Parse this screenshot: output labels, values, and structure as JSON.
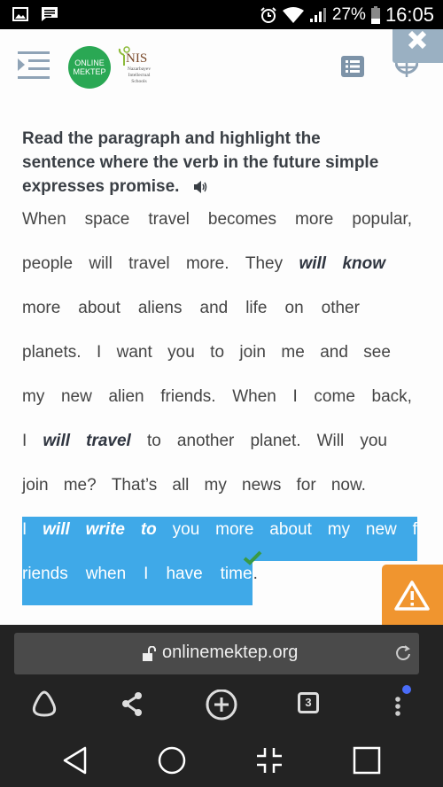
{
  "status_bar": {
    "left_icons": [
      "gallery-notification-icon",
      "message-notification-icon"
    ],
    "right_icons": [
      "alarm-icon",
      "wifi-icon",
      "signal-icon",
      "battery-icon"
    ],
    "battery_percent": "27%",
    "time": "16:05"
  },
  "header": {
    "menu_icon": "sidebar-toggle-icon",
    "logo_online_line1": "ONLINE",
    "logo_online_line2": "MEKTEP",
    "logo_nis_title": "NIS",
    "logo_nis_subtitle": "Nazarbayev Intellectual Schools",
    "list_icon": "list-icon",
    "globe_icon": "globe-icon",
    "close_icon": "close-icon"
  },
  "task": {
    "instruction": "Read the paragraph and highlight the sentence where the verb in the future simple expresses promise.",
    "audio_icon": "speaker-icon"
  },
  "passage": {
    "lines": [
      {
        "segments": [
          {
            "t": "When"
          },
          {
            "t": "space"
          },
          {
            "t": "travel"
          },
          {
            "t": "becomes"
          },
          {
            "t": "more"
          },
          {
            "t": "popular,"
          }
        ]
      },
      {
        "segments": [
          {
            "t": "people"
          },
          {
            "t": "will"
          },
          {
            "t": "travel"
          },
          {
            "t": "more."
          },
          {
            "t": "They"
          },
          {
            "t": "will",
            "b": true
          },
          {
            "t": "know",
            "b": true
          }
        ]
      },
      {
        "segments": [
          {
            "t": "more"
          },
          {
            "t": "about"
          },
          {
            "t": "aliens"
          },
          {
            "t": "and"
          },
          {
            "t": "life"
          },
          {
            "t": "on"
          },
          {
            "t": "other"
          }
        ]
      },
      {
        "segments": [
          {
            "t": "planets."
          },
          {
            "t": "I"
          },
          {
            "t": "want"
          },
          {
            "t": "you"
          },
          {
            "t": "to"
          },
          {
            "t": "join"
          },
          {
            "t": "me"
          },
          {
            "t": "and"
          },
          {
            "t": "see"
          }
        ]
      },
      {
        "segments": [
          {
            "t": "my"
          },
          {
            "t": "new"
          },
          {
            "t": "alien"
          },
          {
            "t": "friends."
          },
          {
            "t": "When"
          },
          {
            "t": "I"
          },
          {
            "t": "come"
          },
          {
            "t": "back,"
          }
        ]
      },
      {
        "segments": [
          {
            "t": "I"
          },
          {
            "t": "will",
            "b": true
          },
          {
            "t": "travel",
            "b": true
          },
          {
            "t": "to"
          },
          {
            "t": "another"
          },
          {
            "t": "planet."
          },
          {
            "t": "Will"
          },
          {
            "t": "you"
          }
        ]
      },
      {
        "segments": [
          {
            "t": "join"
          },
          {
            "t": "me?"
          },
          {
            "t": "That’s"
          },
          {
            "t": "all"
          },
          {
            "t": "my"
          },
          {
            "t": "news"
          },
          {
            "t": "for"
          },
          {
            "t": "now."
          }
        ]
      },
      {
        "highlighted": true,
        "segments": [
          {
            "t": "I"
          },
          {
            "t": "will",
            "b": true
          },
          {
            "t": "write",
            "b": true
          },
          {
            "t": "to",
            "b": true
          },
          {
            "t": "you"
          },
          {
            "t": "more"
          },
          {
            "t": "about"
          },
          {
            "t": "my"
          },
          {
            "t": "new"
          },
          {
            "t": "f"
          }
        ]
      },
      {
        "highlighted": true,
        "segments": [
          {
            "t": "riends"
          },
          {
            "t": "when"
          },
          {
            "t": "I"
          },
          {
            "t": "have"
          },
          {
            "t": "time"
          }
        ],
        "trailing": "."
      }
    ],
    "highlight_color": "#3fa9e8",
    "correct_mark_icon": "checkmark-icon",
    "correct_mark_color": "#3a9a44"
  },
  "report_button": {
    "icon": "warning-icon",
    "color": "#f0952f"
  },
  "browser": {
    "url": "onlinemektep.org",
    "lock_icon": "unlocked-padlock-icon",
    "reload_icon": "reload-icon",
    "toolbar": [
      {
        "name": "alice-assistant-icon"
      },
      {
        "name": "share-icon"
      },
      {
        "name": "new-tab-icon"
      },
      {
        "name": "tabs-count",
        "value": "3"
      },
      {
        "name": "more-menu-icon"
      }
    ]
  },
  "nav_bar": [
    "back-icon",
    "home-icon",
    "split-screen-icon",
    "recents-icon"
  ]
}
